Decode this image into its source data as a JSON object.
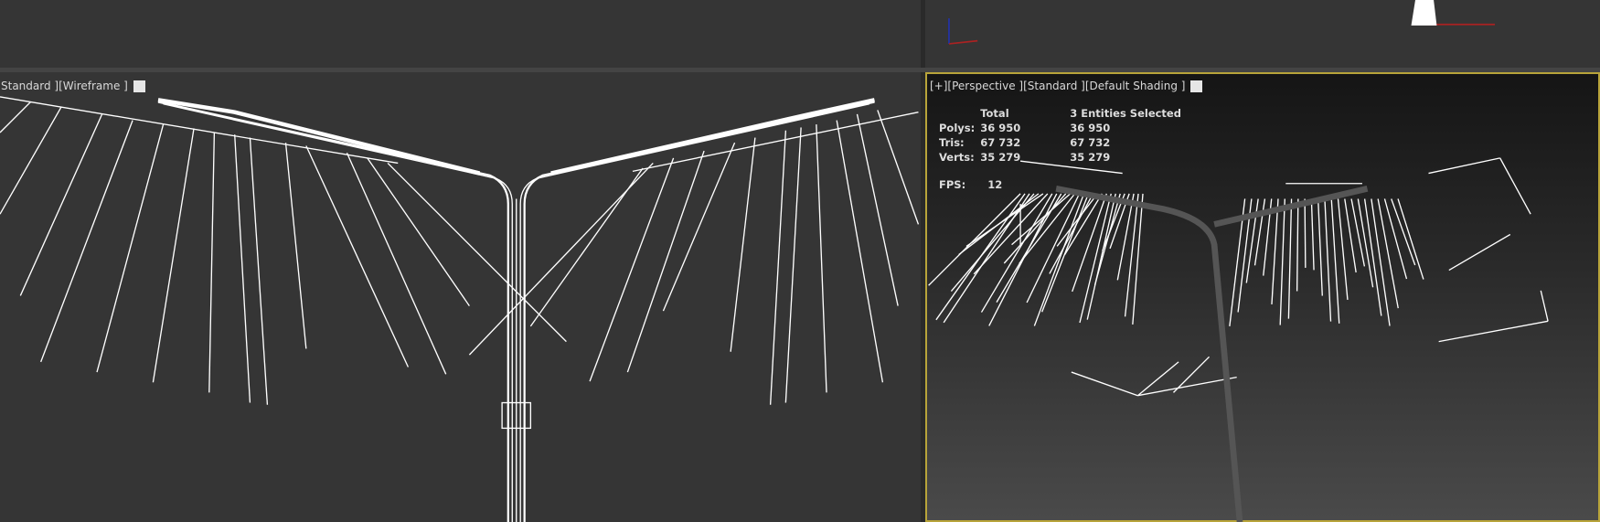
{
  "left_viewport": {
    "label": "Standard ][Wireframe ]"
  },
  "right_viewport": {
    "label": "[+][Perspective ][Standard ][Default Shading ]",
    "stats": {
      "headers": [
        "",
        "Total",
        "3 Entities Selected"
      ],
      "rows": [
        {
          "label": "Polys:",
          "total": "36 950",
          "selected": "36 950"
        },
        {
          "label": "Tris:",
          "total": "67 732",
          "selected": "67 732"
        },
        {
          "label": "Verts:",
          "total": "35 279",
          "selected": "35 279"
        }
      ],
      "fps_label": "FPS:",
      "fps": "12"
    }
  },
  "colors": {
    "active_border": "#b8a43a",
    "viewport_bg": "#353535"
  }
}
